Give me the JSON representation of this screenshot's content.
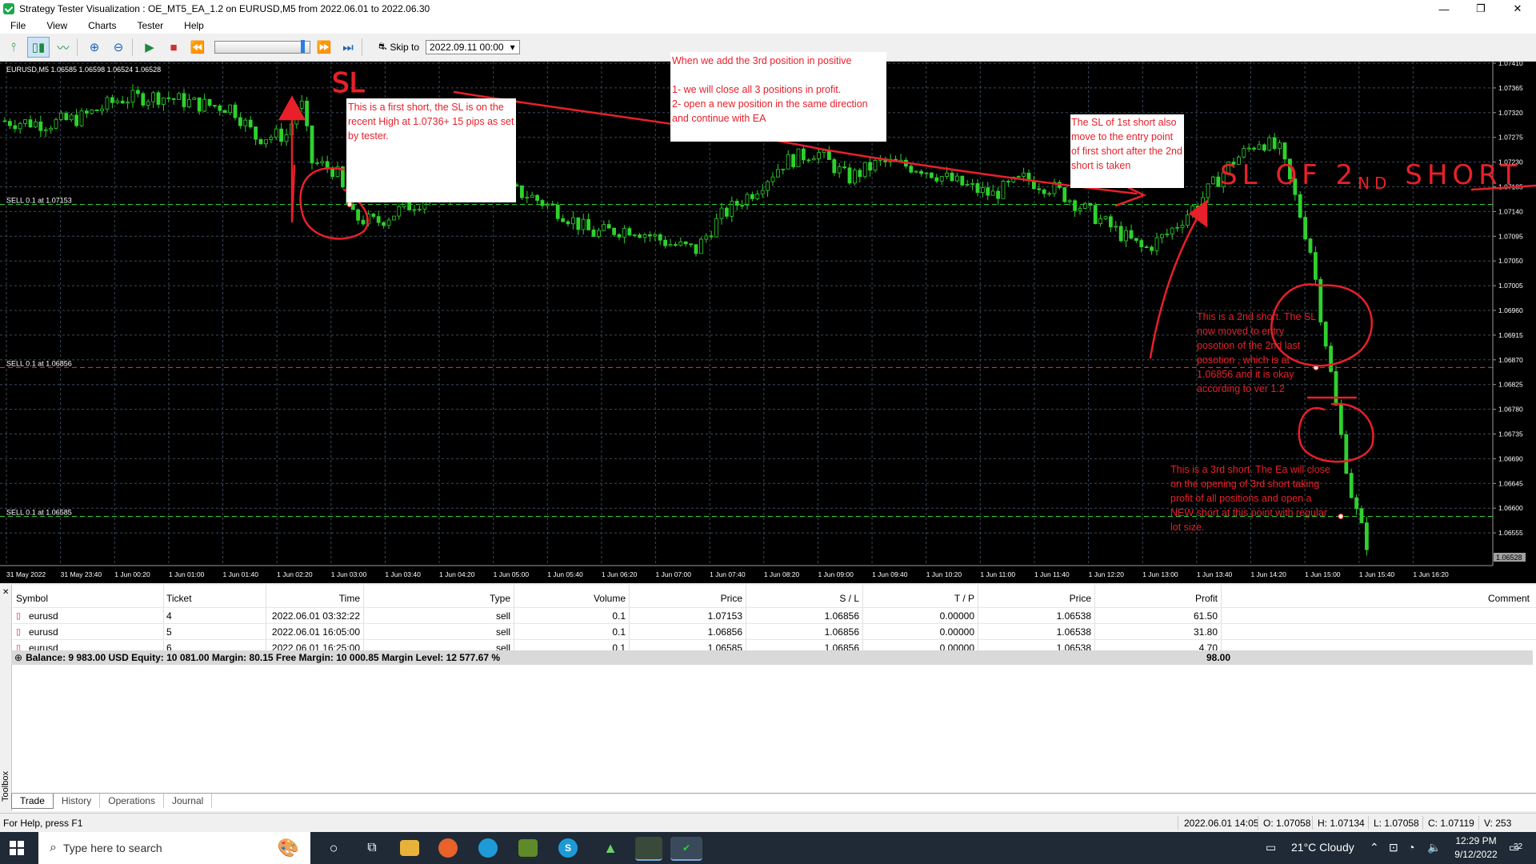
{
  "window": {
    "title": "Strategy Tester Visualization : OE_MT5_EA_1.2 on EURUSD,M5 from 2022.06.01 to 2022.06.30",
    "minimize": "—",
    "maximize": "❐",
    "close": "✕"
  },
  "menu": [
    "File",
    "View",
    "Charts",
    "Tester",
    "Help"
  ],
  "toolbar": {
    "skip_label": "Skip to",
    "skip_value": "2022.09.11 00:00"
  },
  "chart": {
    "header": "EURUSD,M5  1.06585 1.06598 1.06524 1.06528",
    "price_labels": [
      "1.07410",
      "1.07365",
      "1.07320",
      "1.07275",
      "1.07230",
      "1.07185",
      "1.07140",
      "1.07095",
      "1.07050",
      "1.07005",
      "1.06960",
      "1.06915",
      "1.06870",
      "1.06825",
      "1.06780",
      "1.06735",
      "1.06690",
      "1.06645",
      "1.06600",
      "1.06555"
    ],
    "current_price": "1.06528",
    "time_labels": [
      "31 May 2022",
      "31 May 23:40",
      "1 Jun 00:20",
      "1 Jun 01:00",
      "1 Jun 01:40",
      "1 Jun 02:20",
      "1 Jun 03:00",
      "1 Jun 03:40",
      "1 Jun 04:20",
      "1 Jun 05:00",
      "1 Jun 05:40",
      "1 Jun 06:20",
      "1 Jun 07:00",
      "1 Jun 07:40",
      "1 Jun 08:20",
      "1 Jun 09:00",
      "1 Jun 09:40",
      "1 Jun 10:20",
      "1 Jun 11:00",
      "1 Jun 11:40",
      "1 Jun 12:20",
      "1 Jun 13:00",
      "1 Jun 13:40",
      "1 Jun 14:20",
      "1 Jun 15:00",
      "1 Jun 15:40",
      "1 Jun 16:20"
    ],
    "order_lines": [
      {
        "label": "SELL 0.1 at 1.07153",
        "price": 1.07153,
        "color": "#2ed12e"
      },
      {
        "label": "SELL 0.1 at 1.06856",
        "price": 1.06856,
        "color": "#ff3030"
      },
      {
        "label": "SELL 0.1 at 1.06585",
        "price": 1.06585,
        "color": "#2ed12e"
      }
    ],
    "annotations": {
      "box1": "This is a first short, the SL is on the recent High at 1.0736+ 15 pips as set by tester.",
      "box2": "When we add the 3rd position in positive\n\n1- we will close all 3 positions in profit.\n2- open a new position in the same direction and continue with EA",
      "box3": "The SL of 1st short also move to the entry point of first short after the 2nd short is taken",
      "note2": "This is a 2nd short. The SL now moved to entry posotion of the 2nd last posotion , which is at 1.06856 and it is okay according to ver 1.2",
      "note3": "This is a 3rd short. The Ea will close on the opening of 3rd short taking profit of all positions and open a NEW short at this point with regular lot size.",
      "hand_sl": "SL",
      "hand_sl2_a": "SL OF 2",
      "hand_sl2_b": "ND",
      "hand_sl2_c": " SHORT"
    },
    "colors": {
      "bg": "#000000",
      "candle": "#2ed12e",
      "grid": "#3a4a5a",
      "annotation": "#e8202a"
    }
  },
  "table": {
    "headers": [
      "Symbol",
      "Ticket",
      "Time",
      "Type",
      "Volume",
      "Price",
      "S / L",
      "T / P",
      "Price",
      "Profit",
      "Comment"
    ],
    "rows": [
      [
        "eurusd",
        "4",
        "2022.06.01 03:32:22",
        "sell",
        "0.1",
        "1.07153",
        "1.06856",
        "0.00000",
        "1.06538",
        "61.50"
      ],
      [
        "eurusd",
        "5",
        "2022.06.01 16:05:00",
        "sell",
        "0.1",
        "1.06856",
        "1.06856",
        "0.00000",
        "1.06538",
        "31.80"
      ],
      [
        "eurusd",
        "6",
        "2022.06.01 16:25:00",
        "sell",
        "0.1",
        "1.06585",
        "1.06856",
        "0.00000",
        "1.06538",
        "4.70"
      ]
    ],
    "balance": "Balance: 9 983.00 USD  Equity: 10 081.00  Margin: 80.15  Free Margin: 10 000.85  Margin Level: 12 577.67 %",
    "total_profit": "98.00"
  },
  "side_toolbox": "Toolbox",
  "tabs": [
    "Trade",
    "History",
    "Operations",
    "Journal"
  ],
  "status": {
    "help": "For Help, press F1",
    "datetime": "2022.06.01 14:05",
    "open": "O: 1.07058",
    "high": "H: 1.07134",
    "low": "L: 1.07058",
    "close": "C: 1.07119",
    "volume": "V: 253"
  },
  "taskbar": {
    "search_placeholder": "Type here to search",
    "weather": "21°C  Cloudy",
    "time": "12:29 PM",
    "date": "9/12/2022",
    "notifications": "22"
  }
}
